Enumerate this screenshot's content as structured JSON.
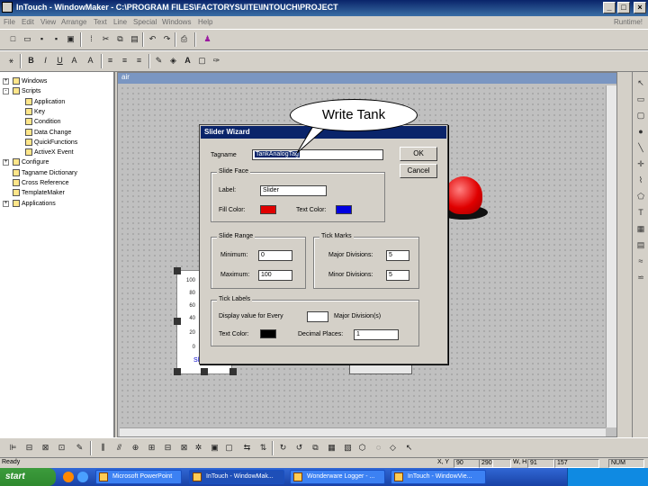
{
  "window": {
    "title": "InTouch - WindowMaker - C:\\PROGRAM FILES\\FACTORYSUITE\\INTOUCH\\PROJECT",
    "min_label": "_",
    "max_label": "□",
    "close_label": "×"
  },
  "menu": {
    "items": [
      "File",
      "Edit",
      "View",
      "Arrange",
      "Text",
      "Line",
      "Special",
      "Windows",
      "Help"
    ],
    "runtime_label": "Runtime!"
  },
  "tree": {
    "items": [
      {
        "label": "Windows",
        "indent": 0,
        "expand": "+"
      },
      {
        "label": "Scripts",
        "indent": 0,
        "expand": "-"
      },
      {
        "label": "Application",
        "indent": 1
      },
      {
        "label": "Key",
        "indent": 1
      },
      {
        "label": "Condition",
        "indent": 1
      },
      {
        "label": "Data Change",
        "indent": 1
      },
      {
        "label": "QuickFunctions",
        "indent": 1
      },
      {
        "label": "ActiveX Event",
        "indent": 1
      },
      {
        "label": "Configure",
        "indent": 0,
        "expand": "+"
      },
      {
        "label": "Tagname Dictionary",
        "indent": 0
      },
      {
        "label": "Cross Reference",
        "indent": 0
      },
      {
        "label": "TemplateMaker",
        "indent": 0
      },
      {
        "label": "Applications",
        "indent": 0,
        "expand": "+"
      }
    ]
  },
  "canvas": {
    "window_title": "air"
  },
  "tank": {
    "scale": [
      "100",
      "80",
      "60",
      "40",
      "20",
      "0"
    ],
    "caption": "Slider"
  },
  "callout": {
    "text": "Write Tank"
  },
  "wizard": {
    "title": "Slider Wizard",
    "tagname_label": "Tagname",
    "tagname_value": "TankAnalogTag",
    "ok_label": "OK",
    "cancel_label": "Cancel",
    "slide_face": {
      "title": "Slide Face",
      "label_label": "Label:",
      "label_value": "Slider",
      "fill_color_label": "Fill Color:",
      "fill_color": "#e00000",
      "text_color_label": "Text Color:",
      "text_color": "#0000e0"
    },
    "slide_range": {
      "title": "Slide Range",
      "min_label": "Minimum:",
      "min_value": "0",
      "max_label": "Maximum:",
      "max_value": "100"
    },
    "tick_marks": {
      "title": "Tick Marks",
      "major_label": "Major Divisions:",
      "major_value": "5",
      "minor_label": "Minor Divisions:",
      "minor_value": "5"
    },
    "tick_labels": {
      "title": "Tick Labels",
      "display_label": "Display value for Every",
      "display_value": "",
      "display_suffix": "Major Division(s)",
      "text_color_label": "Text Color:",
      "text_color": "#000000",
      "decimal_label": "Decimal Places:",
      "decimal_value": "1"
    }
  },
  "status": {
    "left_text": "Ready",
    "xy_label": "X, Y",
    "x_value": "90",
    "y_value": "290",
    "w_label": "W, H",
    "w_value": "91",
    "h_value": "157",
    "num": "NUM"
  },
  "taskbar": {
    "start_label": "start",
    "items": [
      {
        "label": "Microsoft PowerPoint"
      },
      {
        "label": "InTouch - WindowMak..."
      },
      {
        "label": "Wonderware Logger - ..."
      },
      {
        "label": "InTouch - WindowVie..."
      }
    ]
  }
}
